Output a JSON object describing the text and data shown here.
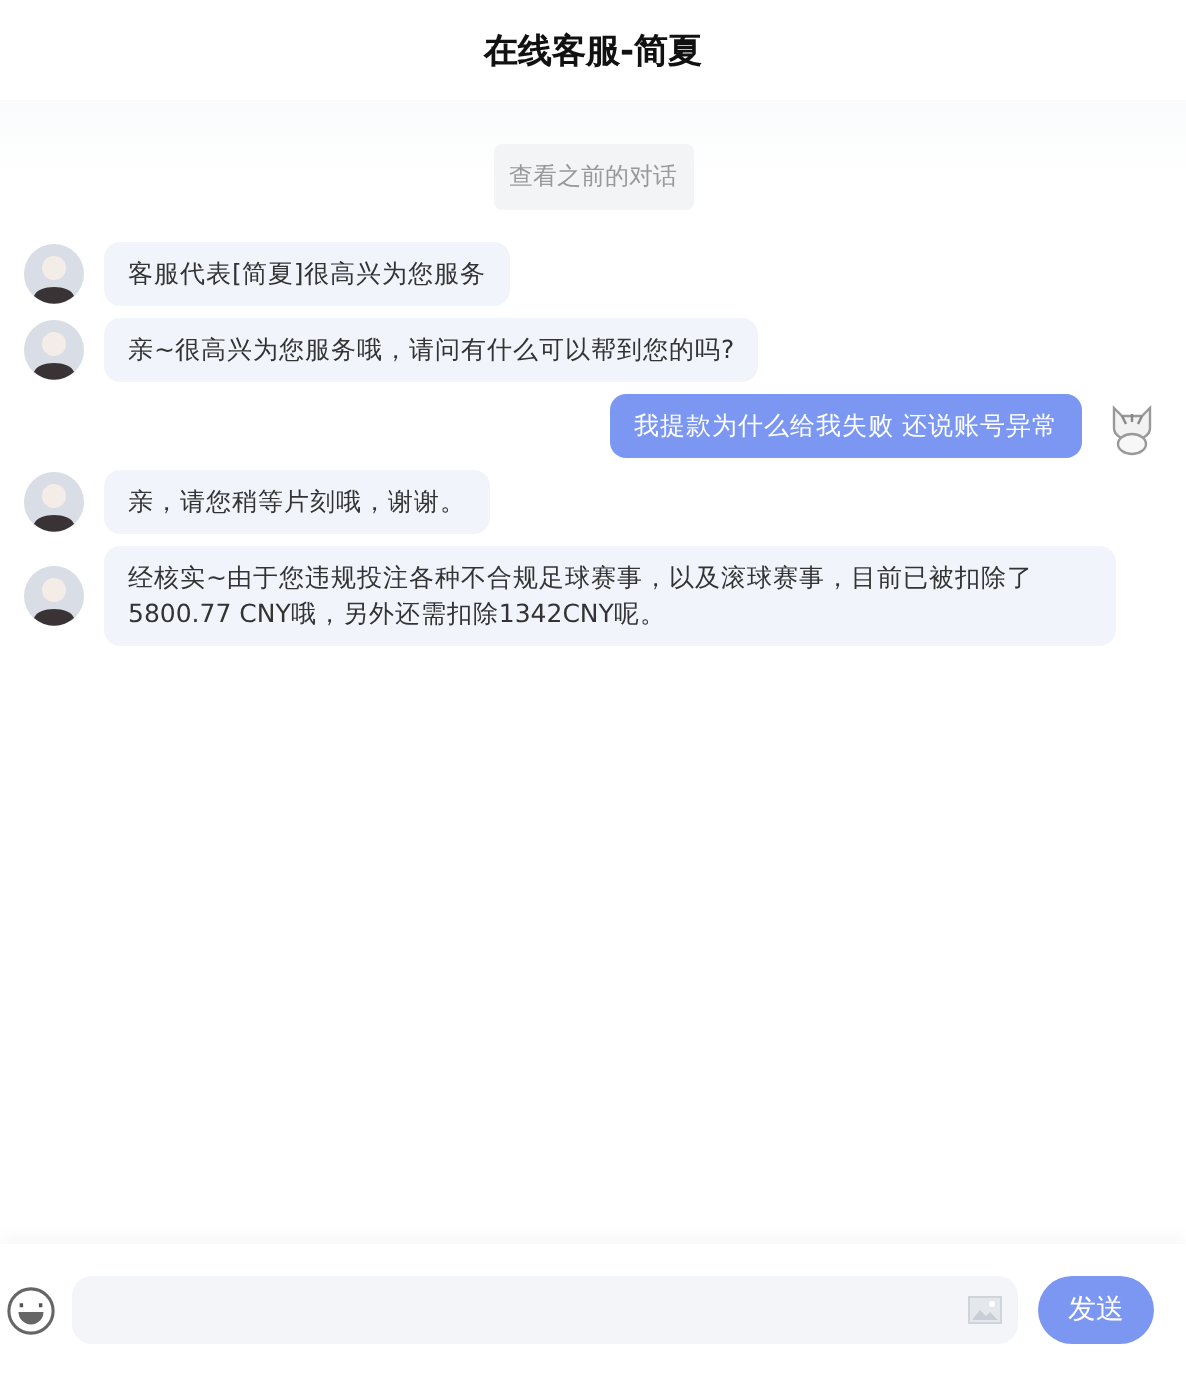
{
  "header": {
    "title": "在线客服-简夏"
  },
  "history_link": "查看之前的对话",
  "messages": [
    {
      "kind": "agent",
      "text": "客服代表[简夏]很高兴为您服务"
    },
    {
      "kind": "agent",
      "text": "亲~很高兴为您服务哦，请问有什么可以帮到您的吗?"
    },
    {
      "kind": "user",
      "text": "我提款为什么给我失败 还说账号异常"
    },
    {
      "kind": "agent",
      "text": "亲，请您稍等片刻哦，谢谢。"
    },
    {
      "kind": "agent",
      "text": "经核实~由于您违规投注各种不合规足球赛事，以及滚球赛事，目前已被扣除了5800.77 CNY哦，另外还需扣除1342CNY呢。"
    }
  ],
  "composer": {
    "send_button": "发送"
  }
}
